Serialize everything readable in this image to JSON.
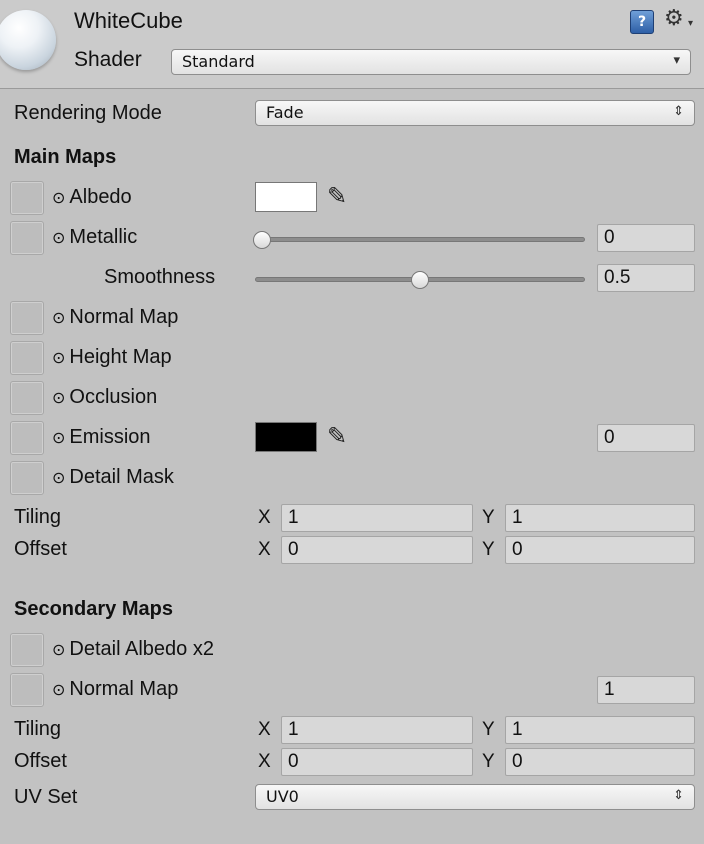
{
  "header": {
    "material_name": "WhiteCube",
    "shader_label": "Shader",
    "shader_value": "Standard",
    "help_glyph": "?",
    "gear_glyph": "⚙",
    "dropdown_arrow": "▾"
  },
  "rendering_mode": {
    "label": "Rendering Mode",
    "value": "Fade",
    "arrow": "⇕"
  },
  "main_maps": {
    "title": "Main Maps",
    "albedo": {
      "label": "Albedo",
      "color": "#ffffff"
    },
    "metallic": {
      "label": "Metallic",
      "value": "0",
      "fraction": 0.0
    },
    "smoothness": {
      "label": "Smoothness",
      "value": "0.5",
      "fraction": 0.5
    },
    "normal_map": {
      "label": "Normal Map"
    },
    "height_map": {
      "label": "Height Map"
    },
    "occlusion": {
      "label": "Occlusion"
    },
    "emission": {
      "label": "Emission",
      "color": "#000000",
      "value": "0"
    },
    "detail_mask": {
      "label": "Detail Mask"
    },
    "tiling": {
      "label": "Tiling",
      "x_label": "X",
      "x": "1",
      "y_label": "Y",
      "y": "1"
    },
    "offset": {
      "label": "Offset",
      "x_label": "X",
      "x": "0",
      "y_label": "Y",
      "y": "0"
    }
  },
  "secondary_maps": {
    "title": "Secondary Maps",
    "detail_albedo": {
      "label": "Detail Albedo x2"
    },
    "normal_map": {
      "label": "Normal Map",
      "value": "1"
    },
    "tiling": {
      "label": "Tiling",
      "x_label": "X",
      "x": "1",
      "y_label": "Y",
      "y": "1"
    },
    "offset": {
      "label": "Offset",
      "x_label": "X",
      "x": "0",
      "y_label": "Y",
      "y": "0"
    },
    "uv_set": {
      "label": "UV Set",
      "value": "UV0",
      "arrow": "⇕"
    }
  },
  "icons": {
    "texture_dot": "⊙",
    "eyedropper": "✎"
  }
}
